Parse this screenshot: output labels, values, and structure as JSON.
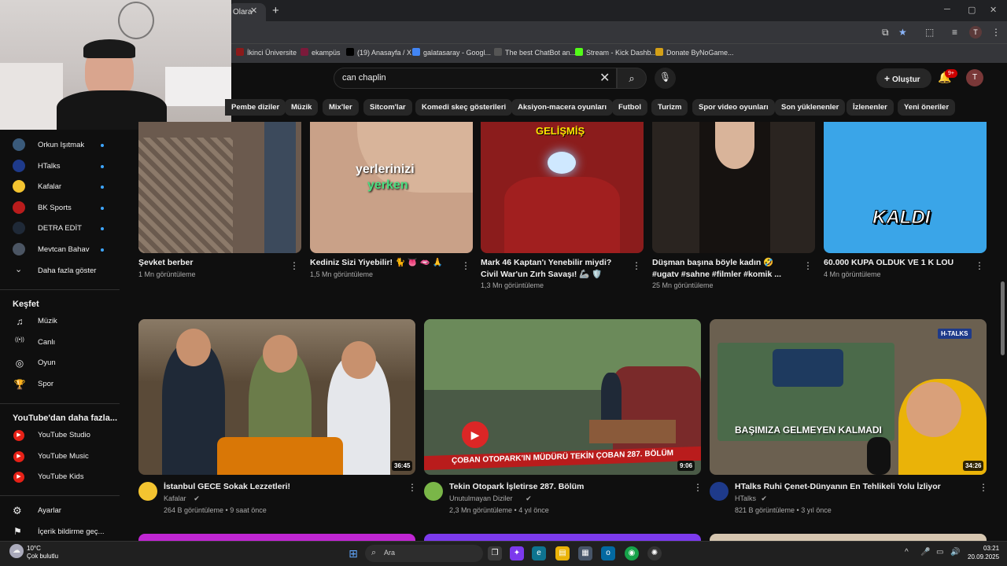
{
  "browser": {
    "tab_title": "Olara",
    "profile_letter": "T",
    "bookmarks": [
      {
        "label": "İkinci Üniversite",
        "color": "#8b1a1a"
      },
      {
        "label": "ekampüs",
        "color": "#7a1a3a"
      },
      {
        "label": "(19) Anasayfa / X",
        "color": "#000000"
      },
      {
        "label": "galatasaray - Googl...",
        "color": "#4285f4"
      },
      {
        "label": "The best ChatBot an...",
        "color": "#555555"
      },
      {
        "label": "Stream - Kick Dashb...",
        "color": "#53fc18"
      },
      {
        "label": "Donate ByNoGame...",
        "color": "#d4a017"
      }
    ]
  },
  "header": {
    "search_value": "can chaplin",
    "create_label": "Oluştur",
    "notif_count": "9+",
    "avatar_letter": "T"
  },
  "chips": [
    "Pembe diziler",
    "Müzik",
    "Mix'ler",
    "Sitcom'lar",
    "Komedi skeç gösterileri",
    "Aksiyon-macera oyunları",
    "Futbol",
    "Turizm",
    "Spor video oyunları",
    "Son yüklenenler",
    "İzlenenler",
    "Yeni öneriler"
  ],
  "sidebar": {
    "subscriptions": [
      {
        "label": "Orkun Işıtmak",
        "color": "#3a5a7a"
      },
      {
        "label": "HTalks",
        "color": "#1e3a8a"
      },
      {
        "label": "Kafalar",
        "color": "#f4c430"
      },
      {
        "label": "BK Sports",
        "color": "#b91c1c"
      },
      {
        "label": "DETRA EDİT",
        "color": "#1f2937"
      },
      {
        "label": "Mevtcan Bahav",
        "color": "#4b5563"
      }
    ],
    "show_more": "Daha fazla göster",
    "explore_title": "Keşfet",
    "explore": [
      "Müzik",
      "Canlı",
      "Oyun",
      "Spor"
    ],
    "more_title": "YouTube'dan daha fazla...",
    "more": [
      "YouTube Studio",
      "YouTube Music",
      "YouTube Kids"
    ],
    "settings": "Ayarlar",
    "report": "İçerik bildirme geç..."
  },
  "row1": [
    {
      "title": "Şevket berber",
      "meta": "1 Mn görüntüleme",
      "overlay": "",
      "overlay2": "",
      "bg": "#6b5a4e"
    },
    {
      "title": "Kediniz Sizi Yiyebilir! 🐈 👅 🫦 🙏",
      "meta": "1,5 Mn görüntüleme",
      "overlay": "yerlerinizi",
      "overlay2": "yerken",
      "bg": "#c9a188"
    },
    {
      "title": "Mark 46 Kaptan'ı Yenebilir miydi? Civil War'un Zırh Savaşı! 🦾 🛡️",
      "meta": "1,3 Mn görüntüleme",
      "overlay": "GELİŞMİŞ",
      "overlay2": "",
      "bg": "#8b1c1c"
    },
    {
      "title": "Düşman başına böyle kadın 🤣 #ugatv #sahne #filmler #komik ...",
      "meta": "25 Mn görüntüleme",
      "overlay": "",
      "overlay2": "",
      "bg": "#2a2420"
    },
    {
      "title": "60.000 KUPA OLDUK VE 1 K LOU",
      "meta": "4 Mn görüntüleme",
      "overlay": "KALDI",
      "overlay2": "",
      "bg": "#3aa5e8"
    }
  ],
  "row2": [
    {
      "title": "İstanbul GECE Sokak Lezzetleri!",
      "channel": "Kafalar",
      "meta": "264 B görüntüleme • 9 saat önce",
      "duration": "36:45",
      "overlay": "",
      "bg": "#5a4a38",
      "avatar": "#f4c430"
    },
    {
      "title": "Tekin Otopark İşletirse 287. Bölüm",
      "channel": "Unutulmayan Diziler",
      "meta": "2,3 Mn görüntüleme • 4 yıl önce",
      "duration": "9:06",
      "overlay": "ÇOBAN OTOPARK'IN MÜDÜRÜ TEKİN ÇOBAN 287. BÖLÜM",
      "bg": "#4a5a46",
      "avatar": "#7ab648"
    },
    {
      "title": "HTalks Ruhi Çenet-Dünyanın En Tehlikeli Yolu İzliyor",
      "channel": "HTalks",
      "meta": "821 B görüntüleme • 3 yıl önce",
      "duration": "34:26",
      "overlay": "BAŞIMIZA GELMEYEN KALMADI",
      "bg": "#6b6050",
      "avatar": "#1e3a8a"
    }
  ],
  "taskbar": {
    "weather_temp": "10°C",
    "weather_desc": "Çok bulutlu",
    "search_placeholder": "Ara",
    "time": "03:21",
    "date": "20.09.2025"
  },
  "icons": {
    "search": "search-icon",
    "mic": "mic-icon",
    "bell": "bell-icon",
    "plus": "plus-icon",
    "more": "more-vert-icon"
  }
}
